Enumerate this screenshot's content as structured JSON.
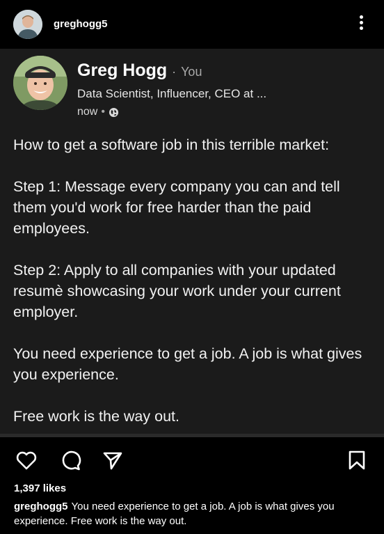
{
  "topbar": {
    "username": "greghogg5"
  },
  "post": {
    "author_name": "Greg Hogg",
    "separator": "·",
    "relation": "You",
    "headline": "Data Scientist, Influencer, CEO at ...",
    "time": "now",
    "time_separator": "•",
    "paragraphs": [
      "How to get a software job in this terrible market:",
      "Step 1: Message every company you can and tell them you'd work for free harder than the paid employees.",
      "Step 2: Apply to all companies with your updated resumè showcasing your work under your current employer.",
      "You need experience to get a job. A job is what gives you experience.",
      "Free work is the way out."
    ]
  },
  "actions": {
    "likes": "1,397 likes",
    "caption_user": "greghogg5",
    "caption_text": "You need experience to get a job. A job is what gives you experience. Free work is the way out."
  },
  "icons": {
    "like": "heart-icon",
    "comment": "comment-icon",
    "share": "send-icon",
    "save": "bookmark-icon",
    "more": "more-icon",
    "visibility": "globe-icon"
  },
  "colors": {
    "background": "#000000",
    "card": "#1b1b1b",
    "muted": "#a9a9a9"
  }
}
